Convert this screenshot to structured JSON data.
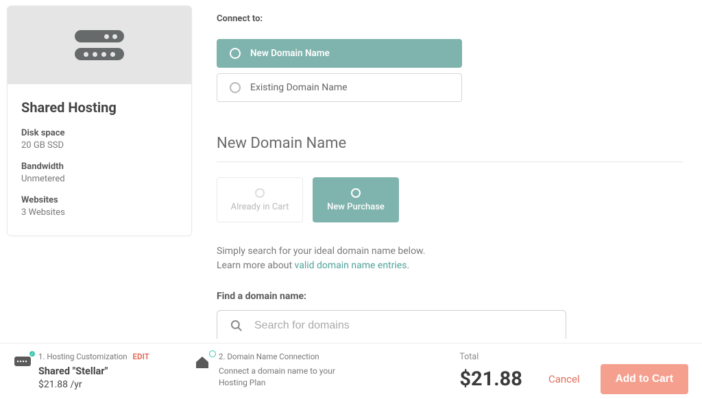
{
  "sidebar": {
    "title": "Shared Hosting",
    "specs": [
      {
        "label": "Disk space",
        "value": "20 GB SSD"
      },
      {
        "label": "Bandwidth",
        "value": "Unmetered"
      },
      {
        "label": "Websites",
        "value": "3 Websites"
      }
    ]
  },
  "connect": {
    "label": "Connect to:",
    "options": {
      "new": "New Domain Name",
      "existing": "Existing Domain Name"
    }
  },
  "section_title": "New Domain Name",
  "purchase_tiles": {
    "in_cart": "Already in Cart",
    "new": "New Purchase"
  },
  "help": {
    "line1": "Simply search for your ideal domain name below.",
    "line2_prefix": "Learn more about ",
    "link": "valid domain name entries",
    "line2_suffix": "."
  },
  "search": {
    "label": "Find a domain name:",
    "placeholder": "Search for domains"
  },
  "footer": {
    "step1": {
      "label": "1. Hosting Customization",
      "edit": "EDIT",
      "title": "Shared \"Stellar\"",
      "price": "$21.88 /yr"
    },
    "step2": {
      "label": "2. Domain Name Connection",
      "desc": "Connect a domain name to your Hosting Plan"
    },
    "total_label": "Total",
    "total_amount": "$21.88",
    "cancel": "Cancel",
    "add_to_cart": "Add to Cart"
  },
  "colors": {
    "accent": "#7fb3ad",
    "danger": "#e06f5c",
    "cta": "#f5a08f"
  }
}
